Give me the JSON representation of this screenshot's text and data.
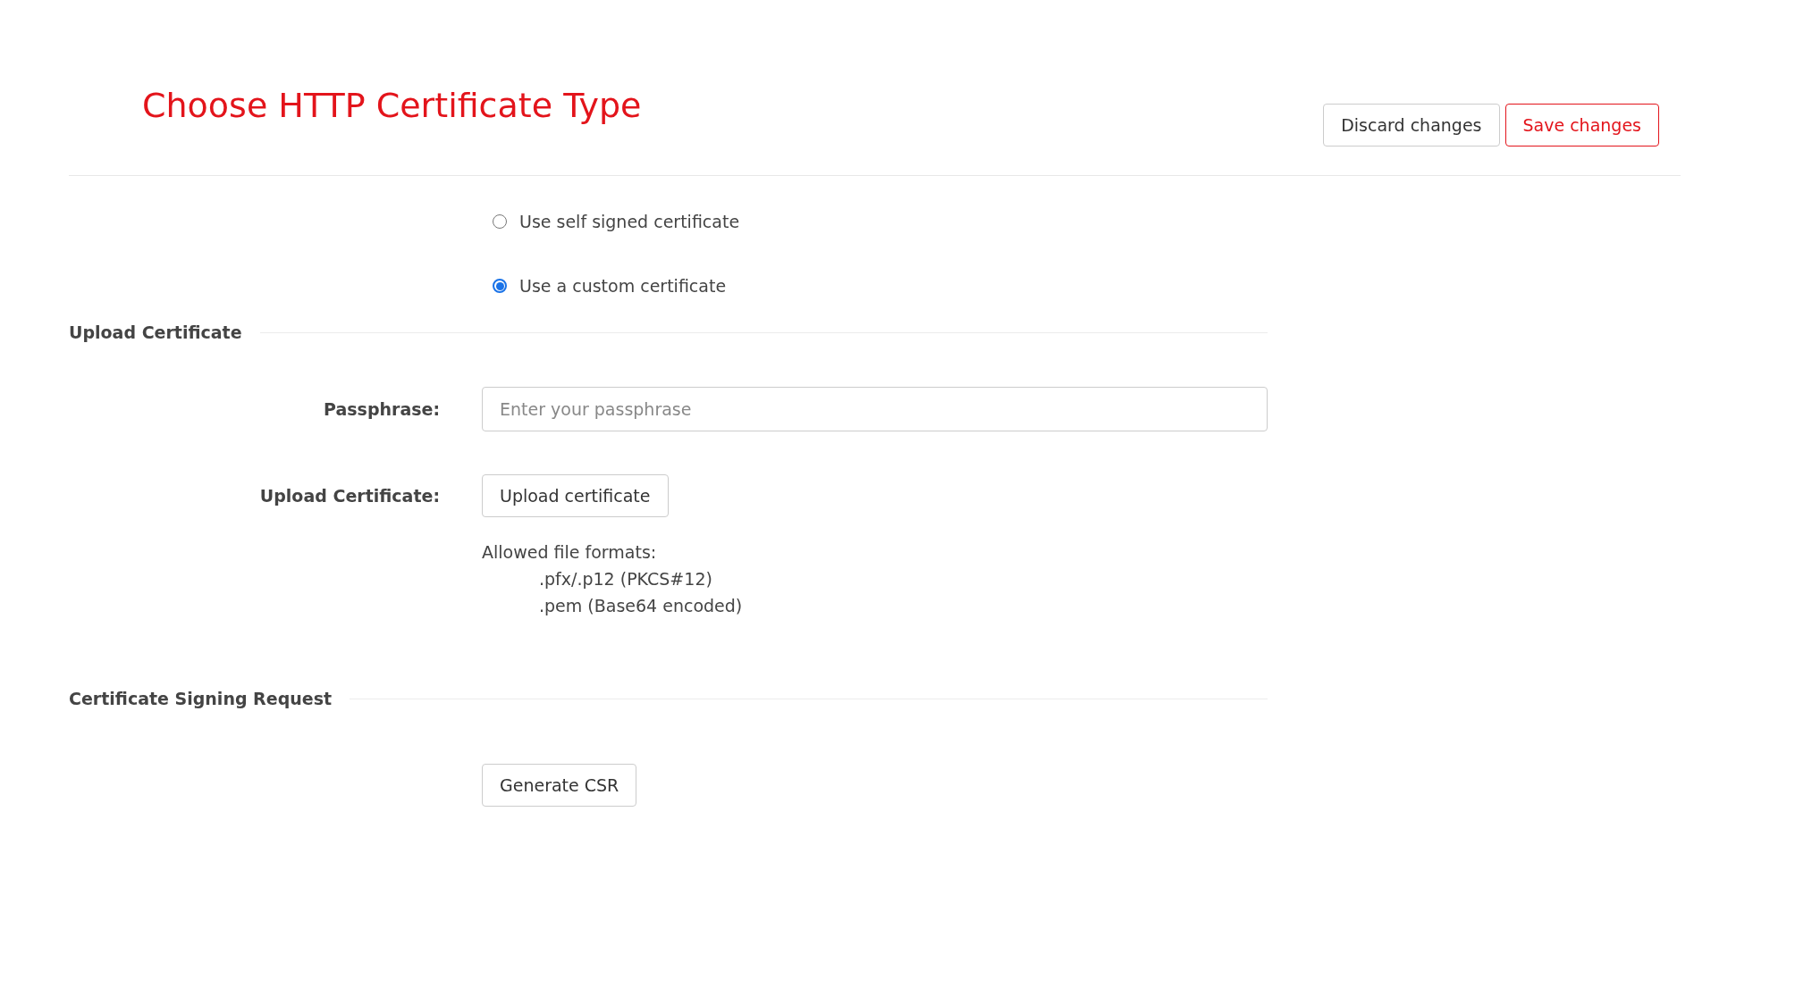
{
  "header": {
    "title": "Choose HTTP Certificate Type",
    "buttons": [
      {
        "label": "Discard changes",
        "kind": "secondary"
      },
      {
        "label": "Save changes",
        "kind": "primary"
      }
    ]
  },
  "certificate_type": [
    {
      "label": "Use self signed certificate",
      "selected": false
    },
    {
      "label": "Use a custom certificate",
      "selected": true
    }
  ],
  "upload_section": {
    "heading": "Upload Certificate",
    "passphrase": {
      "label": "Passphrase:",
      "placeholder": "Enter your passphrase"
    },
    "upload": {
      "label": "Upload Certificate:",
      "button": "Upload certificate"
    },
    "formats": {
      "title": "Allowed file formats:",
      "items": [
        ".pfx/.p12 (PKCS#12)",
        ".pem (Base64 encoded)"
      ]
    }
  },
  "csr_section": {
    "heading": "Certificate Signing Request",
    "button": "Generate CSR"
  }
}
